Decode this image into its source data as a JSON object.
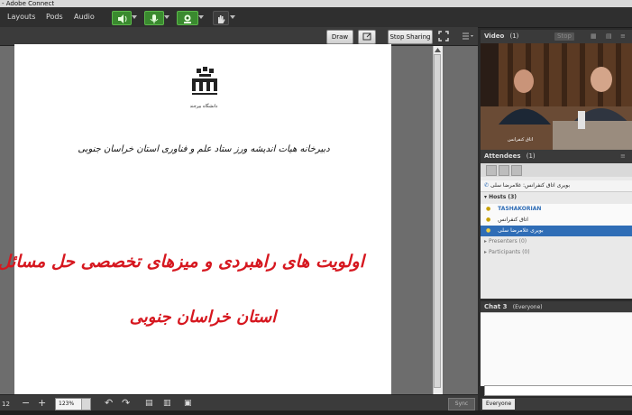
{
  "window": {
    "title": "- Adobe Connect"
  },
  "menu": {
    "items": [
      "Layouts",
      "Pods",
      "Audio"
    ]
  },
  "share": {
    "draw_label": "Draw",
    "stop_sharing_label": "Stop Sharing",
    "page_number": "12",
    "zoom_value": "123%",
    "sync_label": "Sync"
  },
  "slide": {
    "logo_text": "دانشگاه بیرجند",
    "secretariat": "دبیرخانه هیات اندیشه ورز ستاد علم و فناوری استان خراسان جنوبی",
    "title_line1": "اولویت های راهبردی و میزهای تخصصی حل مسائل",
    "title_line2": "استان خراسان جنوبی"
  },
  "video": {
    "title": "Video",
    "count": "(1)",
    "stop_label": "Stop",
    "caption": "اتاق کنفرانس"
  },
  "attendees": {
    "title": "Attendees",
    "count": "(1)",
    "top_row": "بویری اتاق کنفرانس: غلامرضا سلی",
    "hosts_label": "Hosts (3)",
    "hosts": [
      "TASHAKORIAN",
      "اتاق کنفرانس",
      "بویری غلامرضا سلی"
    ],
    "presenters_label": "Presenters (0)",
    "participants_label": "Participants (0)"
  },
  "chat": {
    "title": "Chat 3",
    "scope": "(Everyone)",
    "target_label": "Everyone"
  },
  "colors": {
    "chrome": "#2f2f2f",
    "mic_green": "#3a8a2f",
    "slide_red": "#d6171f",
    "selection_blue": "#2f6db6"
  }
}
